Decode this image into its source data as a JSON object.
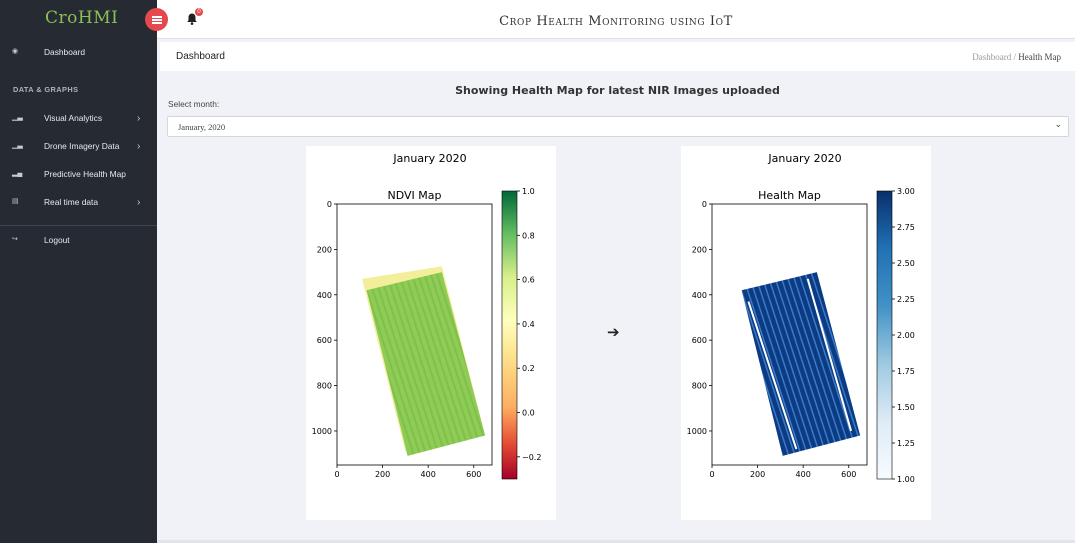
{
  "brand": {
    "logo": "CroHMI"
  },
  "header": {
    "title": "Crop Health Monitoring using IoT",
    "notifications": "0"
  },
  "sidebar": {
    "dashboard": "Dashboard",
    "section": "DATA & GRAPHS",
    "items": [
      {
        "label": "Visual Analytics",
        "icon": "bar-chart-icon",
        "has_submenu": true
      },
      {
        "label": "Drone Imagery Data",
        "icon": "bar-chart-icon",
        "has_submenu": true
      },
      {
        "label": "Predictive Health Map",
        "icon": "area-chart-icon",
        "has_submenu": false
      },
      {
        "label": "Real time data",
        "icon": "table-icon",
        "has_submenu": true
      }
    ],
    "logout": "Logout"
  },
  "page": {
    "title": "Dashboard",
    "breadcrumb": [
      "Dashboard",
      "Health Map"
    ],
    "heading": "Showing Health Map for latest NIR Images uploaded",
    "month_label": "Select month:",
    "month_value": "January, 2020"
  },
  "chart_data": [
    {
      "type": "heatmap",
      "suptitle": "January 2020",
      "title": "NDVI Map",
      "xticks": [
        "0",
        "200",
        "400",
        "600"
      ],
      "yticks": [
        "0",
        "200",
        "400",
        "600",
        "800",
        "1000"
      ],
      "xlim": [
        0,
        680
      ],
      "ylim": [
        1150,
        0
      ],
      "colorbar": {
        "colormap": "RdYlGn",
        "min": -0.3,
        "max": 1.0,
        "ticks": [
          "1.0",
          "0.8",
          "0.6",
          "0.4",
          "0.2",
          "0.0",
          "−0.2"
        ]
      }
    },
    {
      "type": "heatmap",
      "suptitle": "January 2020",
      "title": "Health Map",
      "xticks": [
        "0",
        "200",
        "400",
        "600"
      ],
      "yticks": [
        "0",
        "200",
        "400",
        "600",
        "800",
        "1000"
      ],
      "xlim": [
        0,
        680
      ],
      "ylim": [
        1150,
        0
      ],
      "colorbar": {
        "colormap": "Blues",
        "min": 1.0,
        "max": 3.0,
        "ticks": [
          "3.00",
          "2.75",
          "2.50",
          "2.25",
          "2.00",
          "1.75",
          "1.50",
          "1.25",
          "1.00"
        ]
      }
    }
  ],
  "colors": {
    "sidebar_bg": "#252a33",
    "accent_red": "#e5484d",
    "logo_green": "#8cc152"
  },
  "arrow_icon": "arrow-right-icon"
}
